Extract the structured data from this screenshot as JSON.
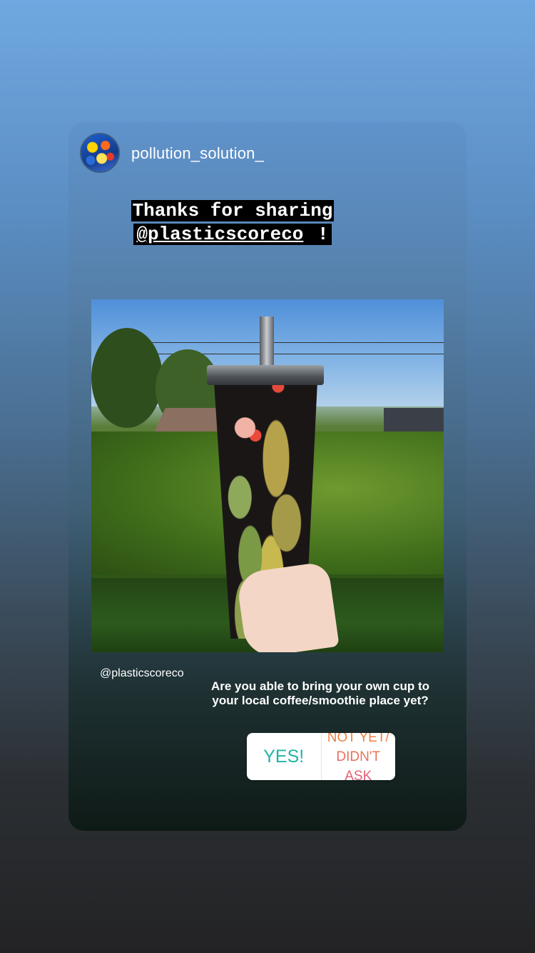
{
  "story": {
    "username": "pollution_solution_",
    "caption_line1": "Thanks for sharing",
    "caption_line2_mention": "@plasticscoreco",
    "caption_line2_suffix": " !",
    "photo_credit": "@plasticscoreco"
  },
  "poll": {
    "question": "Are you able to bring your own cup to your local coffee/smoothie place yet?",
    "option_yes": "YES!",
    "option_no_line1": "NOT YET/",
    "option_no_line2": "DIDN'T ASK"
  },
  "colors": {
    "yes_accent": "#21b3a4",
    "no_gradient_start": "#f0843c",
    "no_gradient_end": "#e05a7b"
  },
  "icons": {
    "avatar": "profile-avatar-fish-reef"
  }
}
